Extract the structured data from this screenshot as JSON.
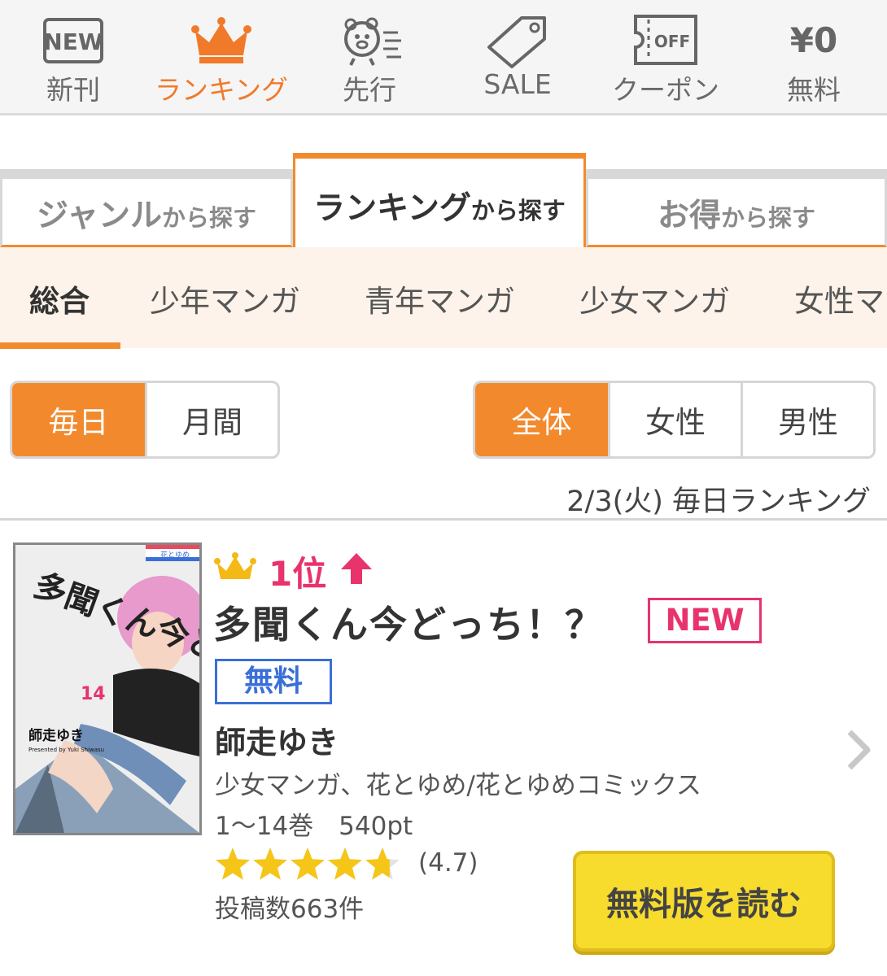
{
  "nav": {
    "items": [
      {
        "label": "新刊",
        "icon": "new-icon",
        "icon_text": "NEW",
        "active": false
      },
      {
        "label": "ランキング",
        "icon": "crown-icon",
        "active": true
      },
      {
        "label": "先行",
        "icon": "running-bear-icon",
        "active": false
      },
      {
        "label": "SALE",
        "icon": "price-tag-icon",
        "active": false
      },
      {
        "label": "クーポン",
        "icon": "coupon-icon",
        "icon_text": "OFF",
        "active": false
      },
      {
        "label": "無料",
        "icon": "yen-zero-icon",
        "icon_text": "¥0",
        "active": false
      }
    ]
  },
  "big_tabs": [
    {
      "bold": "ジャンル",
      "small": "から探す",
      "active": false
    },
    {
      "bold": "ランキング",
      "small": "から探す",
      "active": true
    },
    {
      "bold": "お得",
      "small": "から探す",
      "active": false
    }
  ],
  "categories": [
    "総合",
    "少年マンガ",
    "青年マンガ",
    "少女マンガ",
    "女性マ"
  ],
  "active_category": "総合",
  "period_toggle": {
    "options": [
      "毎日",
      "月間"
    ],
    "selected": "毎日"
  },
  "audience_toggle": {
    "options": [
      "全体",
      "女性",
      "男性"
    ],
    "selected": "全体"
  },
  "ranking_date": "2/3(火) 毎日ランキング",
  "item": {
    "cover": {
      "title_text": "多聞くん今どっち!?",
      "volume": "14",
      "author_text": "師走ゆき",
      "credit": "Presented by Yuki Shiwasu",
      "label_text": "花とゆめ"
    },
    "rank": "1位",
    "rank_trend": "up",
    "title": "多聞くん今どっち！？",
    "new_badge": "NEW",
    "free_badge": "無料",
    "author": "師走ゆき",
    "genre": "少女マンガ、花とゆめ/花とゆめコミックス",
    "volumes_price": "1〜14巻　540pt",
    "rating": 4.7,
    "rating_text": "(4.7)",
    "posts": "投稿数663件",
    "read_button": "無料版を読む"
  },
  "colors": {
    "accent": "#f28a2d",
    "rank_pink": "#e8336d",
    "free_blue": "#3a6fd8",
    "star": "#f5c518",
    "button_yellow": "#f7dc2e"
  }
}
